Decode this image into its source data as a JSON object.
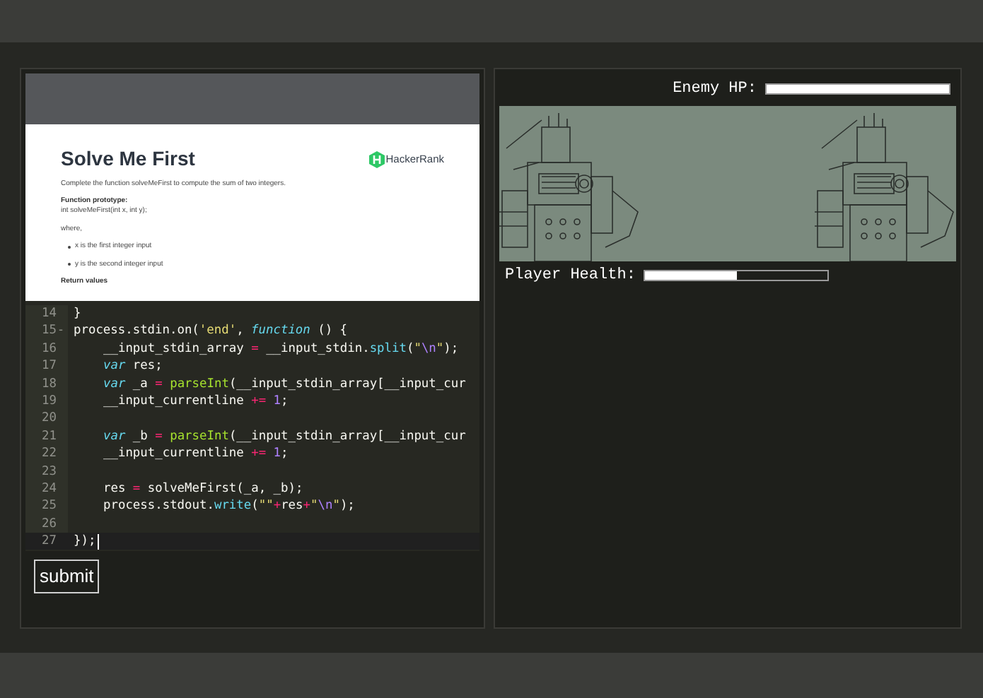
{
  "problem": {
    "title": "Solve Me First",
    "logo_text": "HackerRank",
    "intro": "Complete the function solveMeFirst to compute the sum of two integers.",
    "prototype_heading": "Function prototype:",
    "prototype": "int solveMeFirst(int x, int y);",
    "where": "where,",
    "bullets": [
      "x is the first integer input",
      "y is the second integer input"
    ],
    "return_heading": "Return values"
  },
  "editor": {
    "lines": [
      {
        "number": "14",
        "indented": false,
        "active": false,
        "tokens": [
          {
            "kind": "plain",
            "text": "}"
          }
        ]
      },
      {
        "number": "15",
        "fold_marker": "-",
        "indented": false,
        "active": false,
        "tokens": [
          {
            "kind": "plain",
            "text": "process.stdin.on("
          },
          {
            "kind": "string",
            "text": "'end'"
          },
          {
            "kind": "plain",
            "text": ", "
          },
          {
            "kind": "keyword",
            "text": "function"
          },
          {
            "kind": "plain",
            "text": " () {"
          }
        ]
      },
      {
        "number": "16",
        "indented": true,
        "active": false,
        "tokens": [
          {
            "kind": "plain",
            "text": "__input_stdin_array "
          },
          {
            "kind": "operator",
            "text": "="
          },
          {
            "kind": "plain",
            "text": " __input_stdin."
          },
          {
            "kind": "support",
            "text": "split"
          },
          {
            "kind": "plain",
            "text": "("
          },
          {
            "kind": "string",
            "text": "\""
          },
          {
            "kind": "constant",
            "text": "\\n"
          },
          {
            "kind": "string",
            "text": "\""
          },
          {
            "kind": "plain",
            "text": ");"
          }
        ]
      },
      {
        "number": "17",
        "indented": true,
        "active": false,
        "tokens": [
          {
            "kind": "keyword",
            "text": "var"
          },
          {
            "kind": "plain",
            "text": " res;"
          }
        ]
      },
      {
        "number": "18",
        "indented": true,
        "active": false,
        "tokens": [
          {
            "kind": "keyword",
            "text": "var"
          },
          {
            "kind": "plain",
            "text": " _a "
          },
          {
            "kind": "operator",
            "text": "="
          },
          {
            "kind": "function",
            "text": " parseInt"
          },
          {
            "kind": "plain",
            "text": "(__input_stdin_array[__input_cur"
          }
        ]
      },
      {
        "number": "19",
        "indented": true,
        "active": false,
        "tokens": [
          {
            "kind": "plain",
            "text": "__input_currentline "
          },
          {
            "kind": "operator",
            "text": "+="
          },
          {
            "kind": "constant",
            "text": " 1"
          },
          {
            "kind": "plain",
            "text": ";"
          }
        ]
      },
      {
        "number": "20",
        "active": false
      },
      {
        "number": "21",
        "indented": true,
        "active": false,
        "tokens": [
          {
            "kind": "keyword",
            "text": "var"
          },
          {
            "kind": "plain",
            "text": " _b "
          },
          {
            "kind": "operator",
            "text": "="
          },
          {
            "kind": "function",
            "text": " parseInt"
          },
          {
            "kind": "plain",
            "text": "(__input_stdin_array[__input_cur"
          }
        ]
      },
      {
        "number": "22",
        "indented": true,
        "active": false,
        "tokens": [
          {
            "kind": "plain",
            "text": "__input_currentline "
          },
          {
            "kind": "operator",
            "text": "+="
          },
          {
            "kind": "constant",
            "text": " 1"
          },
          {
            "kind": "plain",
            "text": ";"
          }
        ]
      },
      {
        "number": "23",
        "active": false
      },
      {
        "number": "24",
        "indented": true,
        "active": false,
        "tokens": [
          {
            "kind": "plain",
            "text": "res "
          },
          {
            "kind": "operator",
            "text": "="
          },
          {
            "kind": "plain",
            "text": " solveMeFirst(_a, _b);"
          }
        ]
      },
      {
        "number": "25",
        "indented": true,
        "active": false,
        "tokens": [
          {
            "kind": "plain",
            "text": "process.stdout."
          },
          {
            "kind": "support",
            "text": "write"
          },
          {
            "kind": "plain",
            "text": "("
          },
          {
            "kind": "string",
            "text": "\"\""
          },
          {
            "kind": "operator",
            "text": "+"
          },
          {
            "kind": "plain",
            "text": "res"
          },
          {
            "kind": "operator",
            "text": "+"
          },
          {
            "kind": "string",
            "text": "\""
          },
          {
            "kind": "constant",
            "text": "\\n"
          },
          {
            "kind": "string",
            "text": "\""
          },
          {
            "kind": "plain",
            "text": ");"
          }
        ]
      },
      {
        "number": "26",
        "active": false
      },
      {
        "number": "27",
        "indented": false,
        "active": true,
        "tokens": [
          {
            "kind": "plain",
            "text": "});"
          }
        ]
      }
    ]
  },
  "submit_button": "submit",
  "game": {
    "enemy_hp": {
      "label": "Enemy HP:",
      "level": 1
    },
    "player_health": {
      "label": "Player Health:",
      "level": 0.5
    }
  }
}
